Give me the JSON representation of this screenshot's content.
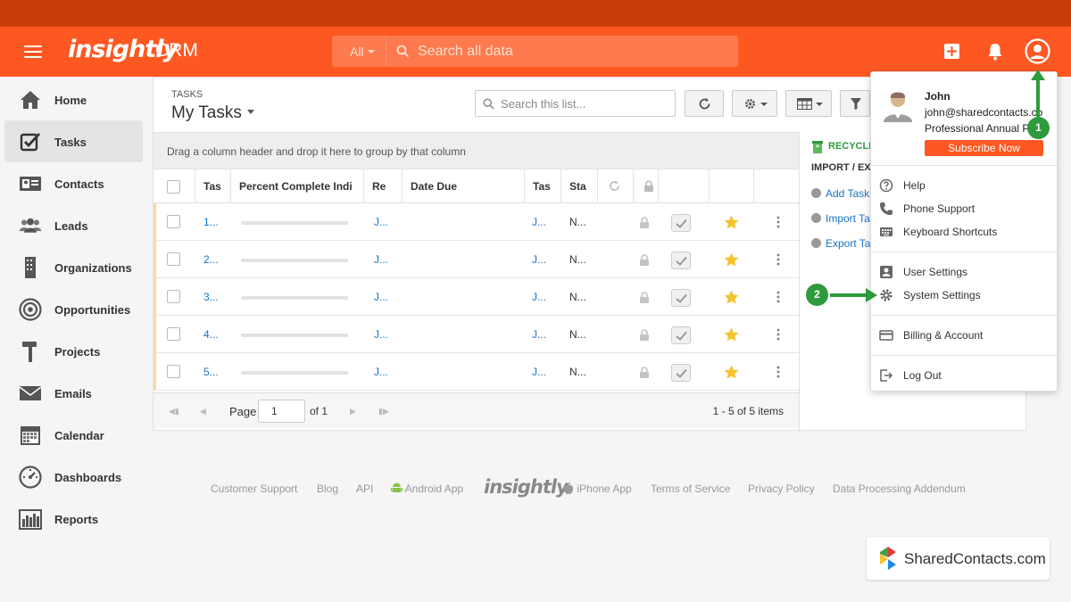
{
  "app": {
    "logo": "insightly",
    "product": "CRM"
  },
  "search": {
    "scope": "All",
    "placeholder": "Search all data"
  },
  "icons": {
    "menu": "hamburger-menu-icon",
    "search": "search-icon",
    "add": "plus-square-icon",
    "notifications": "bell-icon",
    "profile": "user-circle-icon"
  },
  "colors": {
    "brand": "#fd5822",
    "top_strip": "#c93d0b",
    "link": "#1a73c7",
    "annotation_green": "#2e9a3d"
  },
  "sidebar": {
    "items": [
      {
        "label": "Home",
        "icon": "home-icon",
        "active": false
      },
      {
        "label": "Tasks",
        "icon": "checkbox-icon",
        "active": true
      },
      {
        "label": "Contacts",
        "icon": "contact-card-icon",
        "active": false
      },
      {
        "label": "Leads",
        "icon": "leads-people-icon",
        "active": false
      },
      {
        "label": "Organizations",
        "icon": "building-icon",
        "active": false
      },
      {
        "label": "Opportunities",
        "icon": "target-icon",
        "active": false
      },
      {
        "label": "Projects",
        "icon": "hammer-icon",
        "active": false
      },
      {
        "label": "Emails",
        "icon": "envelope-icon",
        "active": false
      },
      {
        "label": "Calendar",
        "icon": "calendar-icon",
        "active": false
      },
      {
        "label": "Dashboards",
        "icon": "gauge-icon",
        "active": false
      },
      {
        "label": "Reports",
        "icon": "bar-chart-icon",
        "active": false
      }
    ]
  },
  "tasks": {
    "section_label": "TASKS",
    "view_title": "My Tasks",
    "search_placeholder": "Search this list...",
    "group_hint": "Drag a column header and drop it here to group by that column",
    "columns": [
      "Tas",
      "Percent Complete Indi",
      "Re",
      "Date Due",
      "Tas",
      "Sta"
    ],
    "rows": [
      {
        "task": "1...",
        "responsible": "J...",
        "owner": "J...",
        "status": "N...",
        "progress": 0
      },
      {
        "task": "2...",
        "responsible": "J...",
        "owner": "J...",
        "status": "N...",
        "progress": 0
      },
      {
        "task": "3...",
        "responsible": "J...",
        "owner": "J...",
        "status": "N...",
        "progress": 0
      },
      {
        "task": "4...",
        "responsible": "J...",
        "owner": "J...",
        "status": "N...",
        "progress": 0
      },
      {
        "task": "5...",
        "responsible": "J...",
        "owner": "J...",
        "status": "N...",
        "progress": 0
      }
    ],
    "pager": {
      "page_label": "Page",
      "page_value": "1",
      "of_label": "of 1",
      "items_label": "1 - 5 of 5 items"
    }
  },
  "right_panel": {
    "recycle": "RECYCLE",
    "import_export": "IMPORT / EX",
    "links": [
      "Add Tasks",
      "Import Ta",
      "Export Ta"
    ]
  },
  "user_menu": {
    "name": "John",
    "email": "john@sharedcontacts.co",
    "plan": "Professional Annual P",
    "subscribe": "Subscribe Now",
    "items": [
      {
        "label": "Help",
        "icon": "question-circle-icon"
      },
      {
        "label": "Phone Support",
        "icon": "phone-icon"
      },
      {
        "label": "Keyboard Shortcuts",
        "icon": "keyboard-icon"
      },
      {
        "label": "User Settings",
        "icon": "user-settings-icon"
      },
      {
        "label": "System Settings",
        "icon": "gear-icon"
      },
      {
        "label": "Billing & Account",
        "icon": "credit-card-icon"
      },
      {
        "label": "Log Out",
        "icon": "logout-icon"
      }
    ]
  },
  "annotations": {
    "step1": "1",
    "step2": "2"
  },
  "footer": {
    "links": [
      "Customer Support",
      "Blog",
      "API",
      "Android App",
      "iPhone App",
      "Terms of Service",
      "Privacy Policy",
      "Data Processing Addendum"
    ],
    "logo": "insightly"
  },
  "watermark": {
    "text": "SharedContacts.com"
  }
}
